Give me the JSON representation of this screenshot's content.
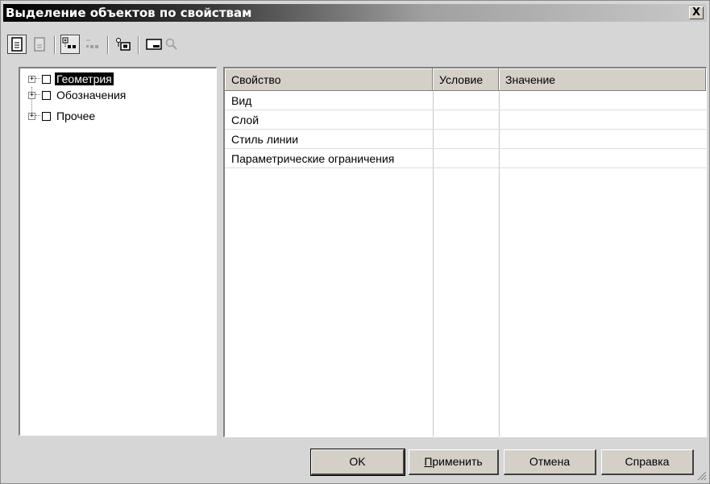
{
  "window": {
    "title": "Выделение объектов по свойствам",
    "close_symbol": "X"
  },
  "toolbar": {
    "buttons": [
      {
        "icon": "document-icon",
        "state": "pressed"
      },
      {
        "icon": "document-disabled-icon",
        "state": "disabled"
      },
      {
        "icon": "tree-expand-icon",
        "state": "pressed"
      },
      {
        "icon": "tree-collapse-icon",
        "state": "disabled"
      },
      {
        "icon": "object-select-icon",
        "state": "normal"
      },
      {
        "icon": "window-icon",
        "state": "normal"
      },
      {
        "icon": "magnifier-icon",
        "state": "disabled"
      }
    ]
  },
  "tree": {
    "items": [
      {
        "label": "Геометрия",
        "expander": "+",
        "checked": false,
        "selected": true
      },
      {
        "label": "Обозначения",
        "expander": "+",
        "checked": false,
        "selected": false
      },
      {
        "label": "Прочее",
        "expander": "+",
        "checked": false,
        "selected": false
      }
    ]
  },
  "grid": {
    "columns": [
      "Свойство",
      "Условие",
      "Значение"
    ],
    "rows": [
      [
        "Вид",
        "",
        ""
      ],
      [
        "Слой",
        "",
        ""
      ],
      [
        "Стиль линии",
        "",
        ""
      ],
      [
        "Параметрические ограничения",
        "",
        ""
      ]
    ]
  },
  "buttons": {
    "ok": "OK",
    "apply_mnemonic": "П",
    "apply_rest": "рименить",
    "cancel": "Отмена",
    "help": "Справка"
  }
}
